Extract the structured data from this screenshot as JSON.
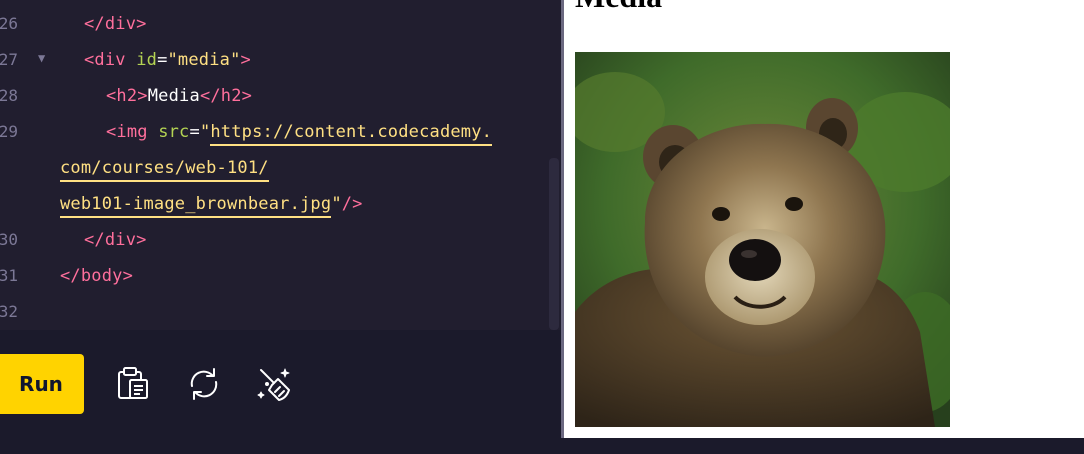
{
  "editor": {
    "lines": [
      {
        "no": "26",
        "parts": [
          {
            "t": "tag",
            "v": "</div>"
          }
        ]
      },
      {
        "no": "27",
        "fold": "▼",
        "parts": [
          {
            "t": "tag",
            "v": "<div "
          },
          {
            "t": "attr",
            "v": "id"
          },
          {
            "t": "eq",
            "v": "="
          },
          {
            "t": "str",
            "v": "\"media\""
          },
          {
            "t": "tag",
            "v": ">"
          }
        ]
      },
      {
        "no": "28",
        "parts": [
          {
            "t": "tag",
            "v": "<h2>"
          },
          {
            "t": "text",
            "v": "Media"
          },
          {
            "t": "tag",
            "v": "</h2>"
          }
        ]
      },
      {
        "no": "29",
        "parts": [
          {
            "t": "tag",
            "v": "<img "
          },
          {
            "t": "attr",
            "v": "src"
          },
          {
            "t": "eq",
            "v": "="
          },
          {
            "t": "str",
            "v": "\""
          },
          {
            "t": "link",
            "v": "https://content.codecademy."
          }
        ]
      },
      {
        "no": "",
        "parts": [
          {
            "t": "link",
            "v": "com/courses/web-101/"
          }
        ]
      },
      {
        "no": "",
        "parts": [
          {
            "t": "link",
            "v": "web101-image_brownbear.jpg"
          },
          {
            "t": "str",
            "v": "\""
          },
          {
            "t": "tag",
            "v": "/>"
          }
        ]
      },
      {
        "no": "30",
        "parts": [
          {
            "t": "tag",
            "v": "</div>"
          }
        ]
      },
      {
        "no": "31",
        "parts": [
          {
            "t": "tag",
            "v": "</body>"
          }
        ]
      },
      {
        "no": "32",
        "parts": []
      }
    ]
  },
  "toolbar": {
    "run_label": "Run",
    "icons": [
      "clipboard-icon",
      "refresh-icon",
      "magic-broom-icon"
    ]
  },
  "preview": {
    "heading": "Media",
    "image_alt": "brown bear"
  },
  "colors": {
    "editor_bg": "#211e2f",
    "tag": "#ff6f9c",
    "attr": "#b4d353",
    "string": "#ffe083",
    "run_button": "#ffd300"
  }
}
